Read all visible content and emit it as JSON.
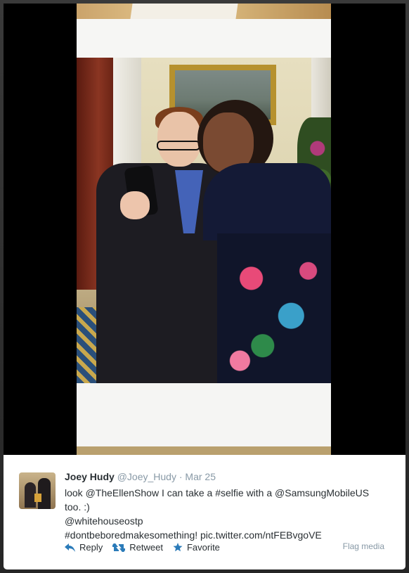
{
  "tweet": {
    "display_name": "Joey Hudy",
    "handle": "@Joey_Hudy",
    "separator": "·",
    "date": "Mar 25",
    "text_lines": [
      "look @TheEllenShow I can take a #selfie with a @SamsungMobileUS",
      "too. :)",
      "@whitehouseostp",
      "#dontbeboredmakesomething! pic.twitter.com/ntFEBvgoVE"
    ],
    "actions": {
      "reply": "Reply",
      "retweet": "Retweet",
      "favorite": "Favorite"
    },
    "flag_media": "Flag media"
  },
  "icons": {
    "reply": "reply-icon",
    "retweet": "retweet-icon",
    "favorite": "star-icon"
  },
  "colors": {
    "link_blue": "#2b7bb9",
    "muted_gray": "#8899a6",
    "text_dark": "#292f33"
  }
}
